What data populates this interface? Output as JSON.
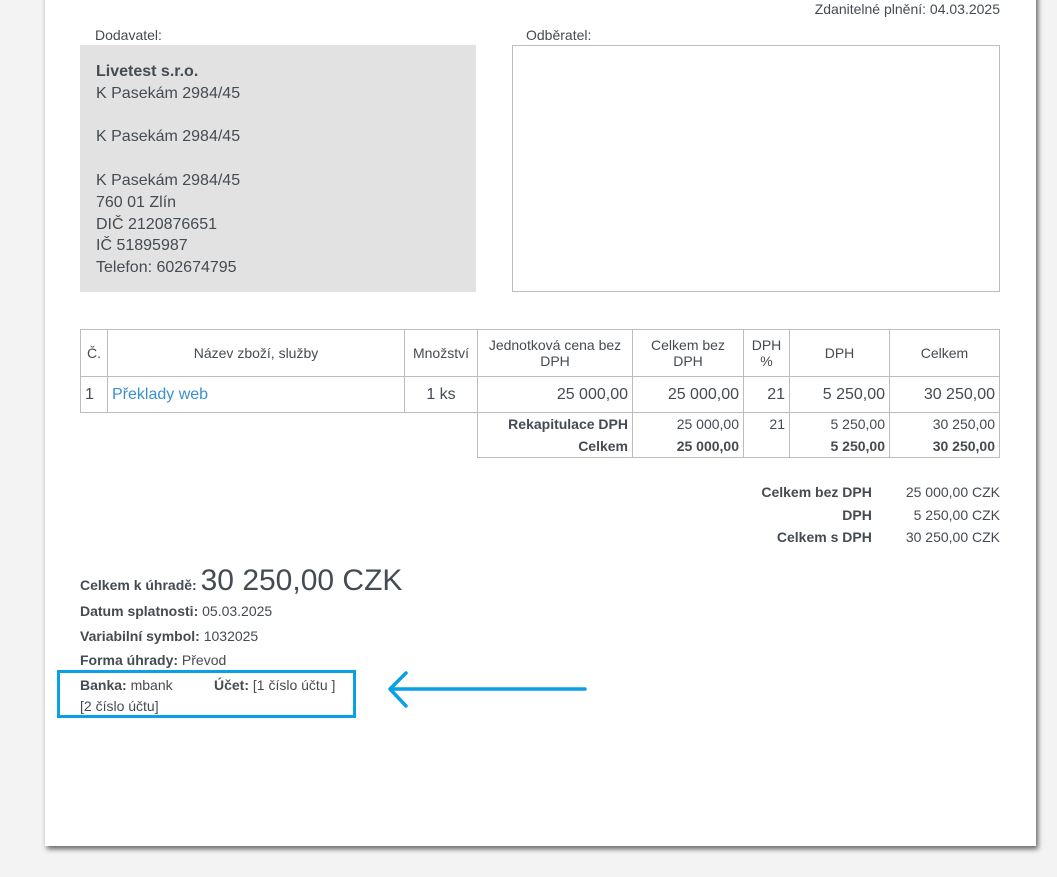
{
  "tax_date": {
    "label": "Zdanitelné plnění:",
    "value": "04.03.2025"
  },
  "supplier": {
    "label": "Dodavatel:",
    "name": "Livetest s.r.o.",
    "lines": [
      "K Pasekám 2984/45",
      "",
      "K Pasekám 2984/45",
      "",
      "K Pasekám 2984/45",
      "760 01 Zlín",
      "DIČ 2120876651",
      "IČ 51895987",
      "Telefon: 602674795"
    ]
  },
  "customer": {
    "label": "Odběratel:"
  },
  "table": {
    "headers": [
      "Č.",
      "Název zboží, služby",
      "Množství",
      "Jednotková cena bez DPH",
      "Celkem bez DPH",
      "DPH %",
      "DPH",
      "Celkem"
    ],
    "rows": [
      {
        "no": "1",
        "name": "Překlady web",
        "qty": "1 ks",
        "unit": "25 000,00",
        "net": "25 000,00",
        "vat_pct": "21",
        "vat": "5 250,00",
        "total": "30 250,00"
      }
    ],
    "recap": {
      "label": "Rekapitulace DPH",
      "net": "25 000,00",
      "vat_pct": "21",
      "vat": "5 250,00",
      "total": "30 250,00"
    },
    "totals": {
      "label": "Celkem",
      "net": "25 000,00",
      "vat": "5 250,00",
      "total": "30 250,00"
    }
  },
  "summary": [
    {
      "label": "Celkem bez DPH",
      "value": "25 000,00 CZK"
    },
    {
      "label": "DPH",
      "value": "5 250,00 CZK"
    },
    {
      "label": "Celkem s DPH",
      "value": "30 250,00 CZK"
    }
  ],
  "payment": {
    "total_label": "Celkem k úhradě:",
    "total": "30 250,00 CZK",
    "due_label": "Datum splatnosti:",
    "due": "05.03.2025",
    "vs_label": "Variabilní symbol:",
    "vs": "1032025",
    "method_label": "Forma úhrady:",
    "method": "Převod",
    "bank_label": "Banka:",
    "bank": "mbank",
    "account_label": "Účet:",
    "account1": "[1 číslo účtu ]",
    "account2": "[2 číslo účtu]"
  },
  "annotation": {
    "color": "#0aa0e6"
  }
}
